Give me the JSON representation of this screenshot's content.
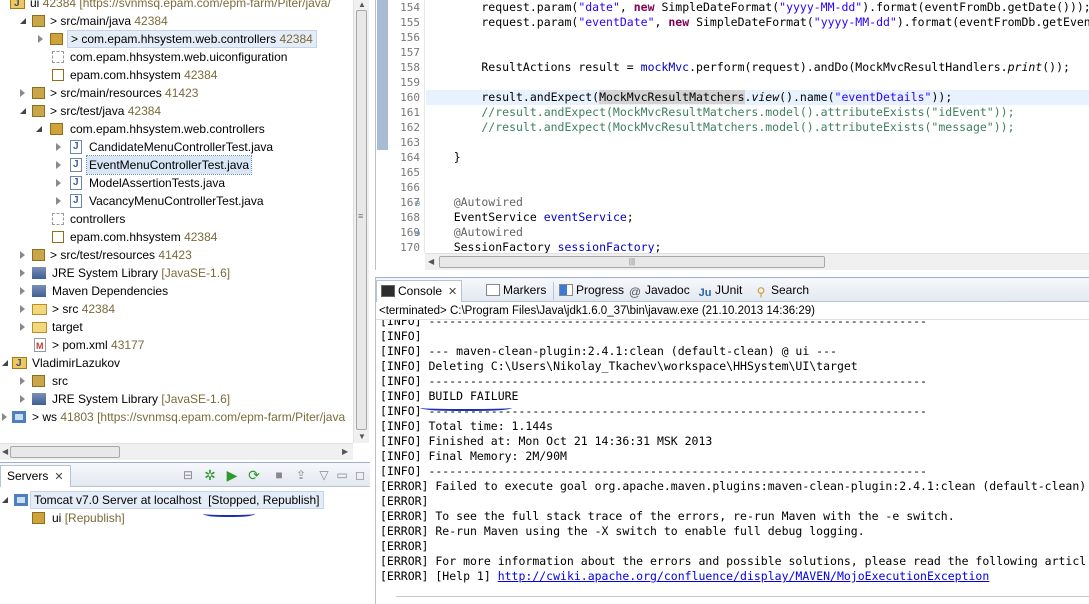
{
  "explorer": {
    "rows": [
      {
        "label": "ui",
        "deco": "42384 [https://svnmsq.epam.com/epm-farm/Piter/java/"
      },
      {
        "label": "> src/main/java",
        "deco": "42384"
      },
      {
        "label": "> com.epam.hhsystem.web.controllers",
        "deco": "42384"
      },
      {
        "label": "com.epam.hhsystem.web.uiconfiguration",
        "deco": ""
      },
      {
        "label": "epam.com.hhsystem",
        "deco": "42384"
      },
      {
        "label": "> src/main/resources",
        "deco": "41423"
      },
      {
        "label": "> src/test/java",
        "deco": "42384"
      },
      {
        "label": "com.epam.hhsystem.web.controllers",
        "deco": ""
      },
      {
        "label": "CandidateMenuControllerTest.java",
        "deco": ""
      },
      {
        "label": "EventMenuControllerTest.java",
        "deco": ""
      },
      {
        "label": "ModelAssertionTests.java",
        "deco": ""
      },
      {
        "label": "VacancyMenuControllerTest.java",
        "deco": ""
      },
      {
        "label": "controllers",
        "deco": ""
      },
      {
        "label": "epam.com.hhsystem",
        "deco": "42384"
      },
      {
        "label": "> src/test/resources",
        "deco": "41423"
      },
      {
        "label": "JRE System Library",
        "deco": "[JavaSE-1.6]"
      },
      {
        "label": "Maven Dependencies",
        "deco": ""
      },
      {
        "label": "> src",
        "deco": "42384"
      },
      {
        "label": "target",
        "deco": ""
      },
      {
        "label": "> pom.xml",
        "deco": "43177"
      },
      {
        "label": "VladimirLazukov",
        "deco": ""
      },
      {
        "label": "src",
        "deco": ""
      },
      {
        "label": "JRE System Library",
        "deco": "[JavaSE-1.6]"
      },
      {
        "label": "> ws",
        "deco": "41803 [https://svnmsq.epam.com/epm-farm/Piter/java"
      }
    ]
  },
  "servers": {
    "tab_label": "Servers",
    "close_glyph": "✕",
    "server_name": "Tomcat v7.0 Server at localhost",
    "server_state": "[Stopped, Republish]",
    "module_name": "ui",
    "module_state": "[Republish]"
  },
  "editor": {
    "line_numbers": [
      "154",
      "155",
      "156",
      "157",
      "158",
      "159",
      "160",
      "161",
      "162",
      "163",
      "164",
      "165",
      "166",
      "167",
      "168",
      "169",
      "170"
    ],
    "lines": {
      "l154a": "        request.param(",
      "l154b": "\"date\"",
      "l154c": ", ",
      "l154d": "new",
      "l154e": " SimpleDateFormat(",
      "l154f": "\"yyyy-MM-dd\"",
      "l154g": ").format(eventFromDb.getDate()));",
      "l155a": "        request.param(",
      "l155b": "\"eventDate\"",
      "l155c": ", ",
      "l155d": "new",
      "l155e": " SimpleDateFormat(",
      "l155f": "\"yyyy-MM-dd\"",
      "l155g": ").format(eventFromDb.getEvent",
      "l158a": "        ResultActions result = ",
      "l158b": "mockMvc",
      "l158c": ".perform(request).andDo(MockMvcResultHandlers.",
      "l158d": "print",
      "l158e": "());",
      "l160a": "        result.andExpect(",
      "l160b": "MockMvcResultMatchers",
      "l160c": ".",
      "l160d": "view",
      "l160e": "().name(",
      "l160f": "\"eventDetails\"",
      "l160g": "));",
      "l161": "        //result.andExpect(MockMvcResultMatchers.model().attributeExists(\"idEvent\"));",
      "l162": "        //result.andExpect(MockMvcResultMatchers.model().attributeExists(\"message\"));",
      "l164": "    }",
      "l167": "    @Autowired",
      "l168a": "    EventService ",
      "l168b": "eventService",
      "l168c": ";",
      "l169": "    @Autowired",
      "l170a": "    SessionFactory ",
      "l170b": "sessionFactory",
      "l170c": ";"
    }
  },
  "console": {
    "tabs": [
      "Console",
      "Markers",
      "Progress",
      "Javadoc",
      "JUnit",
      "Search"
    ],
    "header_prefix": "<terminated> ",
    "header_path": "C:\\Program Files\\Java\\jdk1.6.0_37\\bin\\javaw.exe (21.10.2013 14:36:29)",
    "lines": [
      "[INFO] ------------------------------------------------------------------------",
      "[INFO]",
      "[INFO] --- maven-clean-plugin:2.4.1:clean (default-clean) @ ui ---",
      "[INFO] Deleting C:\\Users\\Nikolay_Tkachev\\workspace\\HHSystem\\UI\\target",
      "[INFO] ------------------------------------------------------------------------",
      "[INFO] BUILD FAILURE",
      "[INFO] ------------------------------------------------------------------------",
      "[INFO] Total time: 1.144s",
      "[INFO] Finished at: Mon Oct 21 14:36:31 MSK 2013",
      "[INFO] Final Memory: 2M/90M",
      "[INFO] ------------------------------------------------------------------------",
      "[ERROR] Failed to execute goal org.apache.maven.plugins:maven-clean-plugin:2.4.1:clean (default-clean)",
      "[ERROR]",
      "[ERROR] To see the full stack trace of the errors, re-run Maven with the -e switch.",
      "[ERROR] Re-run Maven using the -X switch to enable full debug logging.",
      "[ERROR]",
      "[ERROR] For more information about the errors and possible solutions, please read the following articl"
    ],
    "help_prefix": "[ERROR] [Help 1] ",
    "help_link": "http://cwiki.apache.org/confluence/display/MAVEN/MojoExecutionException"
  },
  "colors": {
    "keyword": "#7f0055",
    "string": "#2a00ff",
    "comment": "#3f7f5f",
    "field": "#0000c0",
    "annotation_pen": "#1a2fb8"
  }
}
